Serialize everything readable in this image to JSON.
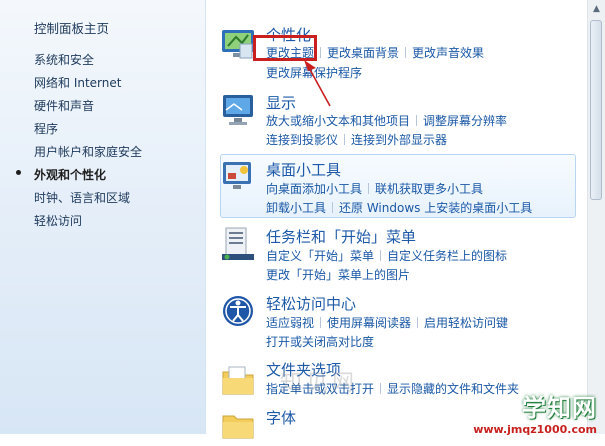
{
  "nav": {
    "home": "控制面板主页",
    "items": [
      {
        "label": "系统和安全",
        "active": false
      },
      {
        "label": "网络和 Internet",
        "active": false
      },
      {
        "label": "硬件和声音",
        "active": false
      },
      {
        "label": "程序",
        "active": false
      },
      {
        "label": "用户帐户和家庭安全",
        "active": false
      },
      {
        "label": "外观和个性化",
        "active": true
      },
      {
        "label": "时钟、语言和区域",
        "active": false
      },
      {
        "label": "轻松访问",
        "active": false
      }
    ]
  },
  "categories": [
    {
      "id": "personalization",
      "icon": "personalization-icon",
      "title": "个性化",
      "rows": [
        [
          "更改主题",
          "更改桌面背景",
          "更改声音效果"
        ],
        [
          "更改屏幕保护程序"
        ]
      ]
    },
    {
      "id": "display",
      "icon": "display-icon",
      "title": "显示",
      "rows": [
        [
          "放大或缩小文本和其他项目",
          "调整屏幕分辨率"
        ],
        [
          "连接到投影仪",
          "连接到外部显示器"
        ]
      ]
    },
    {
      "id": "gadgets",
      "icon": "desktop-gadgets-icon",
      "title": "桌面小工具",
      "rows": [
        [
          "向桌面添加小工具",
          "联机获取更多小工具"
        ],
        [
          "卸载小工具",
          "还原 Windows 上安装的桌面小工具"
        ]
      ]
    },
    {
      "id": "taskbar",
      "icon": "taskbar-icon",
      "title": "任务栏和「开始」菜单",
      "rows": [
        [
          "自定义「开始」菜单",
          "自定义任务栏上的图标"
        ],
        [
          "更改「开始」菜单上的图片"
        ]
      ]
    },
    {
      "id": "ease",
      "icon": "ease-of-access-icon",
      "title": "轻松访问中心",
      "rows": [
        [
          "适应弱视",
          "使用屏幕阅读器",
          "启用轻松访问键"
        ],
        [
          "打开或关闭高对比度"
        ]
      ]
    },
    {
      "id": "folder",
      "icon": "folder-options-icon",
      "title": "文件夹选项",
      "rows": [
        [
          "指定单击或双击打开",
          "显示隐藏的文件和文件夹"
        ]
      ]
    },
    {
      "id": "fonts",
      "icon": "fonts-icon",
      "title": "字体",
      "rows": []
    }
  ],
  "watermark": {
    "logo": "学知网",
    "url": "www.jmqz1000.com",
    "faint": "知见网"
  },
  "colors": {
    "link": "#1a58a6",
    "title": "#1e5aa8",
    "highlight": "#c9201f"
  }
}
